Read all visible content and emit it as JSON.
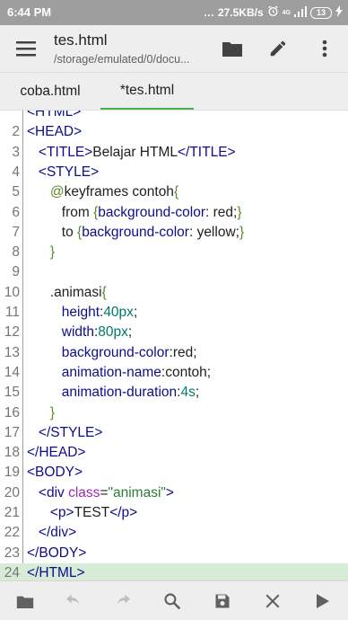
{
  "status_bar": {
    "time": "6:44 PM",
    "net_speed": "27.5KB/s",
    "network_tag": "4G",
    "battery": "13"
  },
  "toolbar": {
    "title": "tes.html",
    "subtitle": "/storage/emulated/0/docu..."
  },
  "tabs": [
    {
      "label": "coba.html",
      "active": false
    },
    {
      "label": "*tes.html",
      "active": true
    }
  ],
  "editor": {
    "highlighted_line": 24,
    "lines": [
      {
        "n": "",
        "tokens": [
          {
            "t": "<HTML>",
            "c": "tag"
          }
        ]
      },
      {
        "n": "2",
        "tokens": [
          {
            "t": "<HEAD>",
            "c": "tag"
          }
        ]
      },
      {
        "n": "3",
        "tokens": [
          {
            "t": "   ",
            "c": "plain"
          },
          {
            "t": "<TITLE>",
            "c": "tag"
          },
          {
            "t": "Belajar HTML",
            "c": "plain"
          },
          {
            "t": "</TITLE>",
            "c": "tag"
          }
        ]
      },
      {
        "n": "4",
        "tokens": [
          {
            "t": "   ",
            "c": "plain"
          },
          {
            "t": "<STYLE>",
            "c": "tag"
          }
        ]
      },
      {
        "n": "5",
        "tokens": [
          {
            "t": "      ",
            "c": "plain"
          },
          {
            "t": "@",
            "c": "brace"
          },
          {
            "t": "keyframes contoh",
            "c": "plain"
          },
          {
            "t": "{",
            "c": "brace"
          }
        ]
      },
      {
        "n": "6",
        "tokens": [
          {
            "t": "         from ",
            "c": "plain"
          },
          {
            "t": "{",
            "c": "brace"
          },
          {
            "t": "background-color",
            "c": "kw"
          },
          {
            "t": ": red;",
            "c": "plain"
          },
          {
            "t": "}",
            "c": "brace"
          }
        ]
      },
      {
        "n": "7",
        "tokens": [
          {
            "t": "         to ",
            "c": "plain"
          },
          {
            "t": "{",
            "c": "brace"
          },
          {
            "t": "background-color",
            "c": "kw"
          },
          {
            "t": ": yellow;",
            "c": "plain"
          },
          {
            "t": "}",
            "c": "brace"
          }
        ]
      },
      {
        "n": "8",
        "tokens": [
          {
            "t": "      ",
            "c": "plain"
          },
          {
            "t": "}",
            "c": "brace"
          }
        ]
      },
      {
        "n": "9",
        "tokens": []
      },
      {
        "n": "10",
        "tokens": [
          {
            "t": "      .animasi",
            "c": "plain"
          },
          {
            "t": "{",
            "c": "brace"
          }
        ]
      },
      {
        "n": "11",
        "tokens": [
          {
            "t": "         ",
            "c": "plain"
          },
          {
            "t": "height",
            "c": "kw"
          },
          {
            "t": ":",
            "c": "plain"
          },
          {
            "t": "40px",
            "c": "val"
          },
          {
            "t": ";",
            "c": "plain"
          }
        ]
      },
      {
        "n": "12",
        "tokens": [
          {
            "t": "         ",
            "c": "plain"
          },
          {
            "t": "width",
            "c": "kw"
          },
          {
            "t": ":",
            "c": "plain"
          },
          {
            "t": "80px",
            "c": "val"
          },
          {
            "t": ";",
            "c": "plain"
          }
        ]
      },
      {
        "n": "13",
        "tokens": [
          {
            "t": "         ",
            "c": "plain"
          },
          {
            "t": "background-color",
            "c": "kw"
          },
          {
            "t": ":red;",
            "c": "plain"
          }
        ]
      },
      {
        "n": "14",
        "tokens": [
          {
            "t": "         ",
            "c": "plain"
          },
          {
            "t": "animation-name",
            "c": "kw"
          },
          {
            "t": ":contoh;",
            "c": "plain"
          }
        ]
      },
      {
        "n": "15",
        "tokens": [
          {
            "t": "         ",
            "c": "plain"
          },
          {
            "t": "animation-duration",
            "c": "kw"
          },
          {
            "t": ":",
            "c": "plain"
          },
          {
            "t": "4s",
            "c": "val"
          },
          {
            "t": ";",
            "c": "plain"
          }
        ]
      },
      {
        "n": "16",
        "tokens": [
          {
            "t": "      ",
            "c": "plain"
          },
          {
            "t": "}",
            "c": "brace"
          }
        ]
      },
      {
        "n": "17",
        "tokens": [
          {
            "t": "   ",
            "c": "plain"
          },
          {
            "t": "</STYLE>",
            "c": "tag"
          }
        ]
      },
      {
        "n": "18",
        "tokens": [
          {
            "t": "</HEAD>",
            "c": "tag"
          }
        ]
      },
      {
        "n": "19",
        "tokens": [
          {
            "t": "<BODY>",
            "c": "tag"
          }
        ]
      },
      {
        "n": "20",
        "tokens": [
          {
            "t": "   ",
            "c": "plain"
          },
          {
            "t": "<div ",
            "c": "tag"
          },
          {
            "t": "class",
            "c": "attr"
          },
          {
            "t": "=",
            "c": "plain"
          },
          {
            "t": "\"animasi\"",
            "c": "str"
          },
          {
            "t": ">",
            "c": "tag"
          }
        ]
      },
      {
        "n": "21",
        "tokens": [
          {
            "t": "      ",
            "c": "plain"
          },
          {
            "t": "<p>",
            "c": "tag"
          },
          {
            "t": "TEST",
            "c": "plain"
          },
          {
            "t": "</p>",
            "c": "tag"
          }
        ]
      },
      {
        "n": "22",
        "tokens": [
          {
            "t": "   ",
            "c": "plain"
          },
          {
            "t": "</div>",
            "c": "tag"
          }
        ]
      },
      {
        "n": "23",
        "tokens": [
          {
            "t": "</BODY>",
            "c": "tag"
          }
        ]
      },
      {
        "n": "24",
        "tokens": [
          {
            "t": "</HTML>",
            "c": "tag"
          }
        ]
      }
    ]
  },
  "icons": {
    "menu": "hamburger-icon",
    "open": "folder-icon",
    "edit": "pencil-icon",
    "more": "more-vert-icon",
    "bottom": [
      "folder-icon",
      "undo-icon",
      "redo-icon",
      "search-icon",
      "save-icon",
      "close-icon",
      "run-icon"
    ]
  },
  "colors": {
    "accent": "#4caf50",
    "highlight_line": "#d7ecd7",
    "status_bar": "#9e9e9e"
  }
}
